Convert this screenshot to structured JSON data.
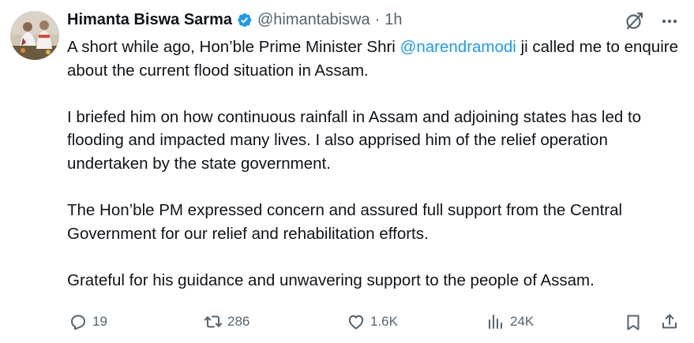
{
  "author": {
    "display_name": "Himanta Biswa Sarma",
    "handle": "@himantabiswa",
    "separator": "·",
    "time": "1h",
    "verified_color": "#1d9bf0"
  },
  "tweet": {
    "para1_before": "A short while ago, Hon’ble Prime Minister Shri ",
    "mention": "@narendramodi",
    "para1_after": " ji called me to enquire about the current flood situation in Assam.",
    "para2": "I briefed him on how continuous rainfall in Assam and adjoining states has led to flooding and impacted many lives. I also apprised him of the relief operation undertaken by the state government.",
    "para3": "The Hon’ble PM expressed concern and assured full support from the Central Government for our relief and rehabilitation efforts.",
    "para4": "Grateful for his guidance and unwavering support to the people of Assam."
  },
  "actions": {
    "replies": "19",
    "reposts": "286",
    "likes": "1.6K",
    "views": "24K"
  },
  "icons": {
    "reply": "reply-icon",
    "repost": "repost-icon",
    "like": "heart-icon",
    "views": "views-icon",
    "bookmark": "bookmark-icon",
    "share": "share-icon",
    "grok": "grok-icon",
    "more": "more-icon"
  },
  "colors": {
    "text": "#0f1419",
    "secondary": "#536471",
    "link": "#1d9bf0"
  }
}
